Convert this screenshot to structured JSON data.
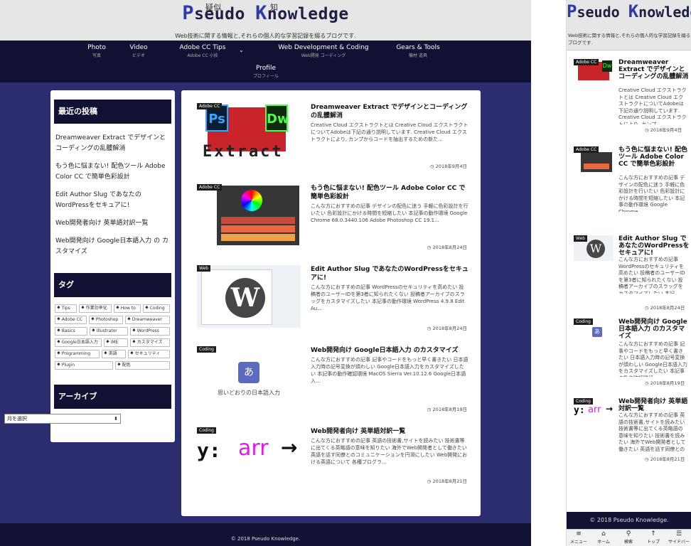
{
  "site": {
    "title_p": "P",
    "title_seudo": "seudo ",
    "title_k": "K",
    "title_nowledge": "nowledge",
    "ruby_1": "疑似",
    "ruby_2": "知",
    "tagline": "Web技術に関する情報と,それらの個人的な学習記録を綴るブログです.",
    "footer": "© 2018 Pseudo Knowledge."
  },
  "nav": [
    {
      "en": "Photo",
      "jp": "写真"
    },
    {
      "en": "Video",
      "jp": "ビデオ"
    },
    {
      "en": "Adobe CC Tips",
      "jp": "Adobe CC 小技"
    },
    {
      "en": "Web Development & Coding",
      "jp": "Web開発 コーディング"
    },
    {
      "en": "Gears & Tools",
      "jp": "機材 道具"
    },
    {
      "en": "Profile",
      "jp": "プロフィール"
    }
  ],
  "sidebar": {
    "recent_heading": "最近の投稿",
    "recent": [
      "Dreamweaver Extract でデザインとコーディングの乱髏解消",
      "もう色に悩まない! 配色ツール Adobe Color CC で簡単色彩設計",
      "Edit Author Slug であなたのWordPressをセキュアに!",
      "Web開発者向け 英単語対訳一覧",
      "Web開発向け Google日本語入力 の カスタマイズ"
    ],
    "tags_heading": "タグ",
    "tags": [
      "Tips",
      "作業効率化",
      "How to",
      "Coding",
      "Adobe CC",
      "Photoshop",
      "Dreamweaver",
      "Basics",
      "Illustrator",
      "WordPress",
      "Google日本語入力",
      "IME",
      "カスタマイズ",
      "Programming",
      "英語",
      "セキュリティ",
      "Plugin",
      "配色"
    ],
    "archive_heading": "アーカイブ",
    "archive_select": "月を選択"
  },
  "posts": [
    {
      "category": "Adobe CC",
      "title": "Dreamweaver Extract でデザインとコーディングの乱髏解消",
      "excerpt": "Creative Cloud エクストラクトとは Creative Cloud エクストラクトについてAdobeは下記の通り説明しています. Creative Cloud エクストラクトにより, カンプからコードを抽出するための新た...",
      "date": "2018年9月4日",
      "mobile_title": "Dreamweaver Extract でデザインとコーディングの乱髏解消",
      "mobile_excerpt": "Creative Cloud エクストラクトとは Creative Cloud エクストラクトについてAdobeは下記の通り説明しています. Creative Cloud エクストラクトにより, カンプ"
    },
    {
      "category": "Adobe CC",
      "title": "もう色に悩まない! 配色ツール Adobe Color CC で簡単色彩設計",
      "excerpt": "こんな方におすすめの記事 デザインの配色に迷う 手軽に色彩設計を行いたい 色彩設計にかける時間を短縮したい 本記事の動作環境 Google Chrome 68.0.3440.106 Adobe Photoshop CC 19.1...",
      "date": "2018年8月24日",
      "mobile_title": "もう色に悩まない! 配色ツール Adobe Color CC で簡単色彩設計",
      "mobile_excerpt": "こんな方におすすめの記事 デザインの配色に迷う 手軽に色彩設計を行いたい 色彩設計にかける時間を短縮したい 本記事の動作環境 Google Chrome"
    },
    {
      "category": "Web",
      "title": "Edit Author Slug であなたのWordPressをセキュアに!",
      "excerpt": "こんな方におすすめの記事 WordPressのセキュリティを高めたい 投稿者のユーザーIDを第3者に知られたくない 投稿者アーカイブのスラッグをカスタマイズしたい 本記事の動作環境 WordPress 4.9.8 Edit Au...",
      "date": "2018年8月24日",
      "mobile_title": "Edit Author Slug であなたのWordPressをセキュアに!",
      "mobile_excerpt": "こんな方におすすめの記事 WordPressのセキュリティを高めたい 投稿者のユーザーIDを第3者に知られたくない 投稿者アーカイブのスラッグをカスタマイズしたい 本記"
    },
    {
      "category": "Coding",
      "title": "Web開発向け Google日本語入力 のカスタマイズ",
      "excerpt": "こんな方におすすめの記事 記事やコードをもっと早く書きたい 日本語入力時の記号変換が煩わしい Google日本語入力をカスタマイズしたい 本記事の動作確認環境 MacOS Sierra Ver.10.12.6 Google日本語入...",
      "date": "2018年8月19日",
      "mobile_title": "Web開発向け Google日本語入力 のカスタマイズ",
      "mobile_excerpt": "こんな方におすすめの記事 記事やコードをもっと早く書きたい 日本語入力時の記号変換が煩わしい Google日本語入力をカスタマイズしたい 本記事の動作確認環境"
    },
    {
      "category": "Coding",
      "title": "Web開発者向け 英単語対訳一覧",
      "excerpt": "こんな方におすすめの記事 英語の技術書,サイトを読みたい 技術書等に出てくる英略語の意味を知りたい 海外でWeb開発者として働きたい 英語を話す同僚とのコミュニケーションを円滑にしたい Web開発における英語について 各種ブログラ...",
      "date": "2018年8月21日",
      "mobile_title": "Web開発者向け 英単語対訳一覧",
      "mobile_excerpt": "こんな方におすすめの記事 英語の技術書,サイトを読みたい 技術書等に出てくる英略語の意味を知りたい 技術書を読みたい 海外でWeb開発者として働きたい 英語を話す同僚とのコミュ"
    }
  ],
  "thumbs": {
    "extract_word": "Extract",
    "ps": "Ps",
    "dw": "Dw",
    "wp_letter": "W",
    "ime_key": "あ",
    "ime_caption": "思いどおりの日本語入力",
    "arr_y": "y:",
    "arr_word": "arr",
    "arr_arrow": "→"
  },
  "mobile_bar": [
    {
      "icon": "≡",
      "label": "メニュー"
    },
    {
      "icon": "⌂",
      "label": "ホーム"
    },
    {
      "icon": "⚲",
      "label": "検索"
    },
    {
      "icon": "↑",
      "label": "トップ"
    },
    {
      "icon": "☰",
      "label": "サイドバー"
    }
  ],
  "colors": {
    "navy": "#111133",
    "page_bg": "#2b2d6e",
    "header_bg": "#e6e6e6"
  }
}
